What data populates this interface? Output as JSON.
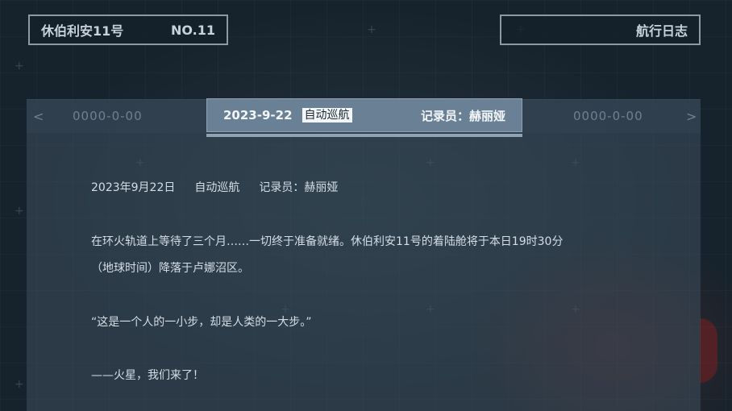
{
  "header": {
    "ship_name": "休伯利安11号",
    "ship_no": "NO.11",
    "log_title": "航行日志"
  },
  "tabs": {
    "prev_date": "0000-0-00",
    "next_date": "0000-0-00",
    "prev_arrow": "<",
    "next_arrow": ">",
    "active": {
      "date": "2023-9-22",
      "mode": "自动巡航",
      "recorder": "记录员：赫丽娅"
    }
  },
  "entry": {
    "date": "2023年9月22日",
    "mode": "自动巡航",
    "recorder": "记录员：赫丽娅",
    "paragraph_line1": "在环火轨道上等待了三个月……一切终于准备就绪。休伯利安11号的着陆舱将于本日19时30分",
    "paragraph_line2": "（地球时间）降落于卢娜沼区。",
    "quote": "“这是一个人的一小步，却是人类的一大步。”",
    "exclaim": "——火星，我们来了！"
  },
  "colors": {
    "background": "#17232c",
    "active_tab": "#6a8094",
    "border": "#8a9aa6"
  }
}
